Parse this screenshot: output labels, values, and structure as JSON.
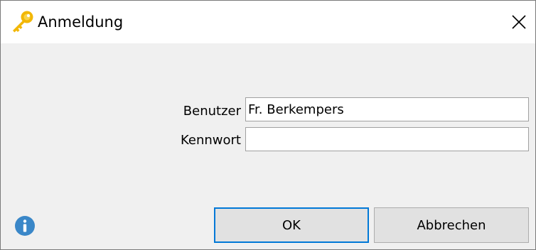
{
  "window": {
    "title": "Anmeldung",
    "title_icon": "key-icon",
    "close_icon": "close-icon"
  },
  "form": {
    "user_label": "Benutzer",
    "user_value": "Fr. Berkempers",
    "password_label": "Kennwort",
    "password_value": ""
  },
  "buttons": {
    "ok_label": "OK",
    "cancel_label": "Abbrechen"
  },
  "footer": {
    "info_icon": "info-icon"
  },
  "colors": {
    "key": "#f2b705",
    "info": "#3a87c8",
    "focus_border": "#0078d7"
  }
}
